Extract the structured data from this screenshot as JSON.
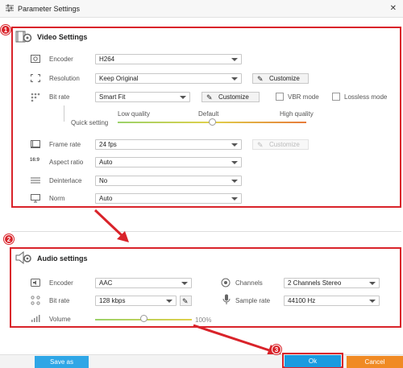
{
  "window": {
    "title": "Parameter Settings",
    "close_glyph": "✕"
  },
  "video": {
    "title": "Video Settings",
    "encoder": {
      "label": "Encoder",
      "value": "H264"
    },
    "resolution": {
      "label": "Resolution",
      "value": "Keep Original",
      "customize": "Customize"
    },
    "bitrate": {
      "label": "Bit rate",
      "value": "Smart Fit",
      "customize": "Customize",
      "vbr": "VBR mode",
      "lossless": "Lossless mode"
    },
    "quality": {
      "low": "Low quality",
      "default": "Default",
      "high": "High quality",
      "label": "Quick setting",
      "level": 0.5
    },
    "framerate": {
      "label": "Frame rate",
      "value": "24 fps",
      "customize": "Customize"
    },
    "aspect": {
      "label": "Aspect ratio",
      "value": "Auto"
    },
    "deinterlace": {
      "label": "Deinterlace",
      "value": "No"
    },
    "norm": {
      "label": "Norm",
      "value": "Auto"
    }
  },
  "audio": {
    "title": "Audio settings",
    "encoder": {
      "label": "Encoder",
      "value": "AAC"
    },
    "channels": {
      "label": "Channels",
      "value": "2 Channels Stereo"
    },
    "bitrate": {
      "label": "Bit rate",
      "value": "128 kbps"
    },
    "samplerate": {
      "label": "Sample rate",
      "value": "44100 Hz"
    },
    "volume": {
      "label": "Volume",
      "value": "100%",
      "level": 0.5
    }
  },
  "footer": {
    "saveas": "Save as",
    "ok": "Ok",
    "cancel": "Cancel"
  },
  "badges": [
    "1",
    "2",
    "3"
  ],
  "colors": {
    "accent_red": "#d9232a",
    "ok_blue": "#1a9be0",
    "cancel_orange": "#f08a24",
    "saveas_blue": "#2fa6e6"
  }
}
